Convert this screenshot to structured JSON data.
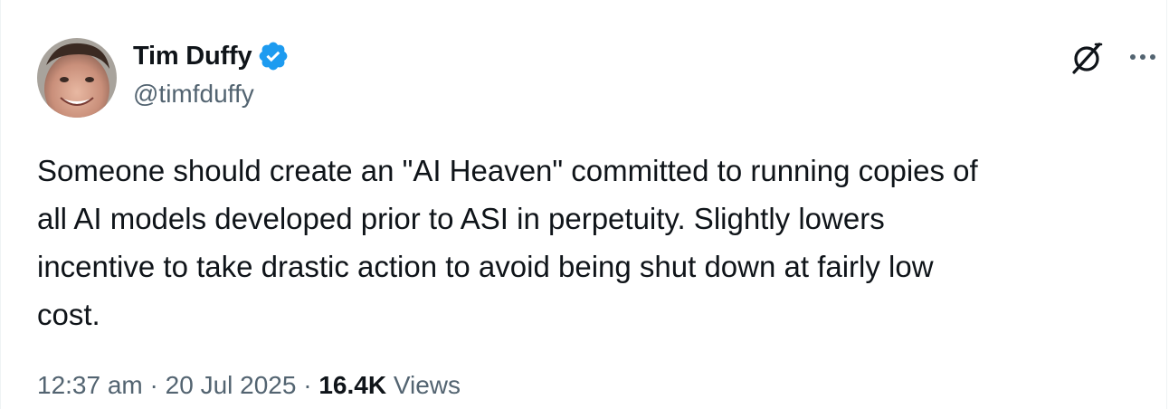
{
  "author": {
    "display_name": "Tim Duffy",
    "handle": "@timfduffy",
    "verified": true,
    "verified_color": "#1d9bf0"
  },
  "icons": {
    "avatar": "avatar",
    "verified": "verified-badge-icon",
    "grok": "grok-icon",
    "more": "more-options-icon"
  },
  "tweet": {
    "text": "Someone should create an \"AI Heaven\" committed to running copies of\nall AI models developed prior to ASI in perpetuity. Slightly lowers\nincentive to take drastic action to avoid being shut down at fairly low\ncost."
  },
  "meta": {
    "time": "12:37 am",
    "separator": " · ",
    "date": "20 Jul 2025",
    "views_count": "16.4K",
    "views_label": " Views"
  },
  "colors": {
    "text_primary": "#0f1419",
    "text_secondary": "#536471",
    "accent": "#1d9bf0"
  }
}
